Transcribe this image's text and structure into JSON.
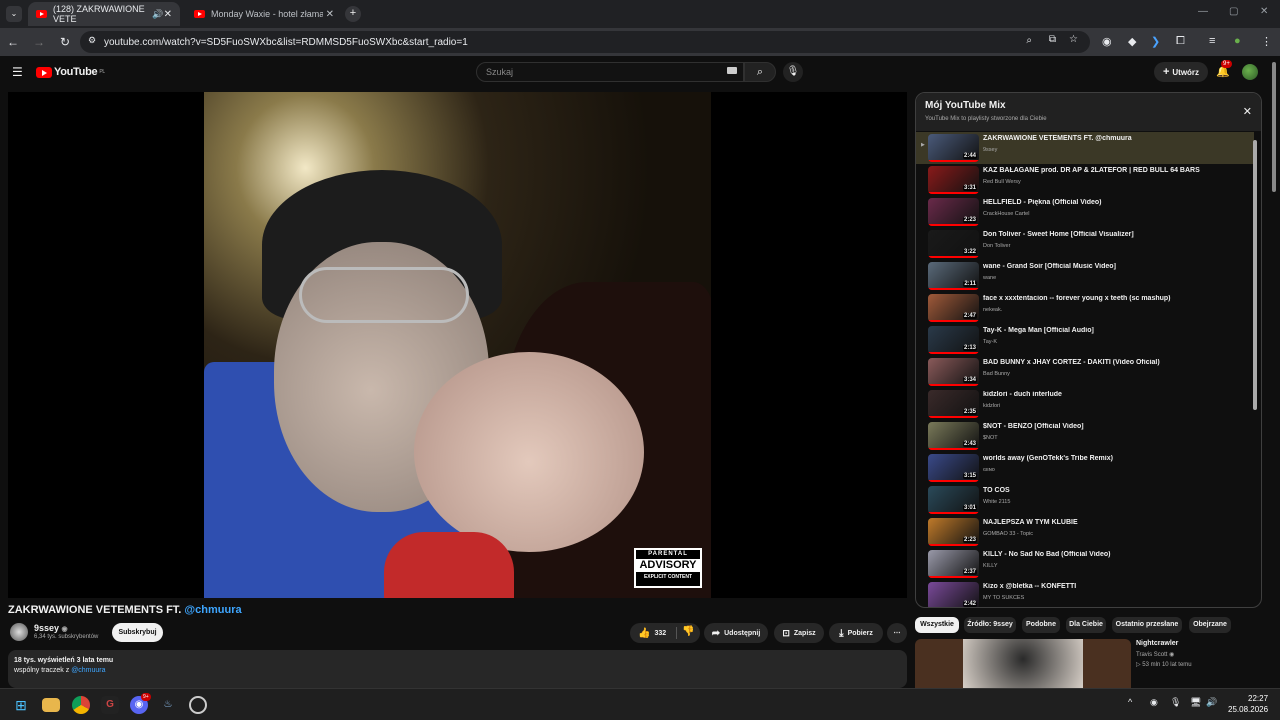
{
  "browser": {
    "tabs": [
      {
        "title": "(128) ZAKRWAWIONE VETE",
        "active": true
      },
      {
        "title": "Monday Waxie - hotel złamany",
        "active": false
      }
    ],
    "url": "youtube.com/watch?v=SD5FuoSWXbc&list=RDMMSD5FuoSWXbc&start_radio=1"
  },
  "header": {
    "logo_text": "YouTube",
    "country": "PL",
    "search_placeholder": "Szukaj",
    "create_label": "Utwórz",
    "notif_badge": "9+"
  },
  "video": {
    "advisory": {
      "line1": "PARENTAL",
      "line2": "ADVISORY",
      "line3": "EXPLICIT CONTENT"
    },
    "title": "ZAKRWAWIONE VETEMENTS FT. ",
    "title_mention": "@chmuura",
    "channel": "9ssey",
    "subscribers": "6,34 tys. subskrybentów",
    "subscribe_label": "Subskrybuj",
    "likes": "332",
    "share_label": "Udostępnij",
    "save_label": "Zapisz",
    "download_label": "Pobierz",
    "stats": "18 tys. wyświetleń  3 lata temu",
    "desc_text": "wspólny traczek z ",
    "desc_mention": "@chmuura"
  },
  "playlist": {
    "title": "Mój YouTube Mix",
    "subtitle": "YouTube Mix to playlisty stworzone dla Ciebie",
    "items": [
      {
        "title": "ZAKRWAWIONE VETEMENTS FT. @chmuura",
        "channel": "9ssey",
        "duration": "2:44",
        "color": "#4a5a7a"
      },
      {
        "title": "KAZ BAŁAGANE prod. DR AP & 2LATEFOR | RED BULL 64 BARS",
        "channel": "Red Bull Wersy",
        "duration": "3:31",
        "color": "#8a1a1a"
      },
      {
        "title": "HELLFIELD - Piękna (Official Video)",
        "channel": "CrackHouse Cartel",
        "duration": "2:23",
        "color": "#6a2a4a"
      },
      {
        "title": "Don Toliver - Sweet Home [Official Visualizer]",
        "channel": "Don Toliver",
        "duration": "3:22",
        "color": "#1a1a1a"
      },
      {
        "title": "wane - Grand Soir [Official Music Video]",
        "channel": "wane",
        "duration": "2:11",
        "color": "#5a6a7a"
      },
      {
        "title": "face x xxxtentacion -- forever young x teeth (sc mashup)",
        "channel": "nekeak.",
        "duration": "2:47",
        "color": "#a05a3a"
      },
      {
        "title": "Tay-K - Mega Man [Official Audio]",
        "channel": "Tay-K",
        "duration": "2:13",
        "color": "#2a3a4a"
      },
      {
        "title": "BAD BUNNY x JHAY CORTEZ - DÁKITI (Video Oficial)",
        "channel": "Bad Bunny",
        "duration": "3:34",
        "color": "#8a5a5a"
      },
      {
        "title": "kidzlori - duch interlude",
        "channel": "kidzlori",
        "duration": "2:35",
        "color": "#3a2a2a"
      },
      {
        "title": "$NOT - BENZO [Official Video]",
        "channel": "$NOT",
        "duration": "2:43",
        "color": "#7a7a5a"
      },
      {
        "title": "worlds away (GenOTekk's Tribe Remix)",
        "channel": "ɢᴇɴᴏ",
        "duration": "3:15",
        "color": "#3a4a8a"
      },
      {
        "title": "TO COŚ",
        "channel": "White 2115",
        "duration": "3:01",
        "color": "#2a4a5a"
      },
      {
        "title": "NAJLEPSZA W TYM KLUBIE",
        "channel": "GOMBAO 33 - Topic",
        "duration": "2:23",
        "color": "#c07a2a"
      },
      {
        "title": "KILLY - No Sad No Bad (Official Video)",
        "channel": "KILLY",
        "duration": "2:37",
        "color": "#9a9aaa"
      },
      {
        "title": "Kizo x @bletka -- KONFETTI",
        "channel": "MY TO SUKCES",
        "duration": "2:42",
        "color": "#7a4a9a"
      }
    ]
  },
  "chips": [
    "Wszystkie",
    "Źródło: 9ssey",
    "Podobne",
    "Dla Ciebie",
    "Ostatnio przesłane",
    "Obejrzane"
  ],
  "recommendation": {
    "title": "Nightcrawler",
    "channel": "Travis Scott",
    "meta": "▷ 53 mln  10 lat temu"
  },
  "taskbar": {
    "time": "22:27",
    "date": "25.08.2026",
    "discord_badge": "9+"
  }
}
